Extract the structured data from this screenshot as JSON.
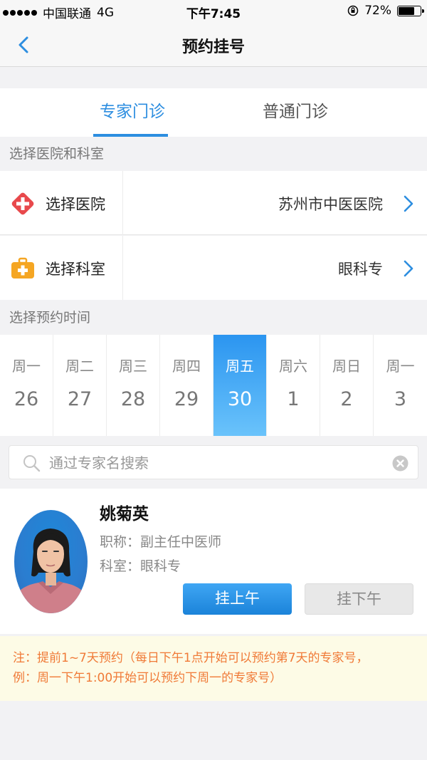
{
  "status_bar": {
    "carrier": "中国联通",
    "network": "4G",
    "time": "下午7:45",
    "battery": "72%",
    "battery_level": 0.72
  },
  "nav": {
    "title": "预约挂号"
  },
  "tabs": [
    {
      "label": "专家门诊",
      "active": true
    },
    {
      "label": "普通门诊",
      "active": false
    }
  ],
  "section_hospital": {
    "header": "选择医院和科室",
    "hospital_label": "选择医院",
    "hospital_value": "苏州市中医医院",
    "dept_label": "选择科室",
    "dept_value": "眼科专"
  },
  "section_time": {
    "header": "选择预约时间"
  },
  "dates": [
    {
      "weekday": "周一",
      "day": "26",
      "selected": false
    },
    {
      "weekday": "周二",
      "day": "27",
      "selected": false
    },
    {
      "weekday": "周三",
      "day": "28",
      "selected": false
    },
    {
      "weekday": "周四",
      "day": "29",
      "selected": false
    },
    {
      "weekday": "周五",
      "day": "30",
      "selected": true
    },
    {
      "weekday": "周六",
      "day": "1",
      "selected": false
    },
    {
      "weekday": "周日",
      "day": "2",
      "selected": false
    },
    {
      "weekday": "周一",
      "day": "3",
      "selected": false
    }
  ],
  "search": {
    "placeholder": "通过专家名搜索",
    "value": ""
  },
  "doctor": {
    "name": "姚菊英",
    "title": "职称：副主任中医师",
    "department": "科室：眼科专",
    "am_button": "挂上午",
    "pm_button": "挂下午"
  },
  "notice": {
    "line1": "注：提前1~7天预约（每日下午1点开始可以预约第7天的专家号，",
    "line2": "例：周一下午1:00开始可以预约下周一的专家号）"
  },
  "colors": {
    "accent": "#2d8ee0",
    "notice_text": "#f07a37",
    "notice_bg": "#fdfbe6",
    "hospital_icon": "#e8494c",
    "dept_icon": "#f5a623"
  },
  "icons": {
    "back": "chevron-left-icon",
    "hospital": "medical-cross-icon",
    "department": "medical-kit-icon",
    "arrow": "chevron-right-icon",
    "search": "search-icon",
    "clear": "clear-circle-icon"
  }
}
